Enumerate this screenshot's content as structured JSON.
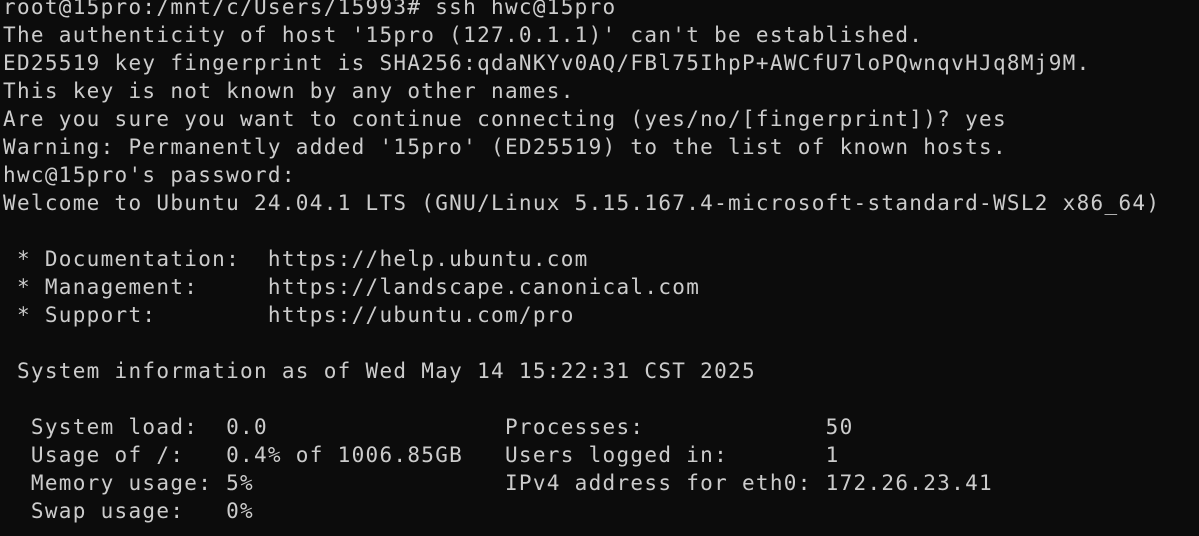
{
  "terminal": {
    "lines": [
      "root@15pro:/mnt/c/Users/15993# ssh hwc@15pro",
      "The authenticity of host '15pro (127.0.1.1)' can't be established.",
      "ED25519 key fingerprint is SHA256:qdaNKYv0AQ/FBl75IhpP+AWCfU7loPQwnqvHJq8Mj9M.",
      "This key is not known by any other names.",
      "Are you sure you want to continue connecting (yes/no/[fingerprint])? yes",
      "Warning: Permanently added '15pro' (ED25519) to the list of known hosts.",
      "hwc@15pro's password:",
      "Welcome to Ubuntu 24.04.1 LTS (GNU/Linux 5.15.167.4-microsoft-standard-WSL2 x86_64)",
      "",
      " * Documentation:  https://help.ubuntu.com",
      " * Management:     https://landscape.canonical.com",
      " * Support:        https://ubuntu.com/pro",
      "",
      " System information as of Wed May 14 15:22:31 CST 2025",
      "",
      "  System load:  0.0                 Processes:             50",
      "  Usage of /:   0.4% of 1006.85GB   Users logged in:       1",
      "  Memory usage: 5%                  IPv4 address for eth0: 172.26.23.41",
      "  Swap usage:   0%"
    ]
  }
}
